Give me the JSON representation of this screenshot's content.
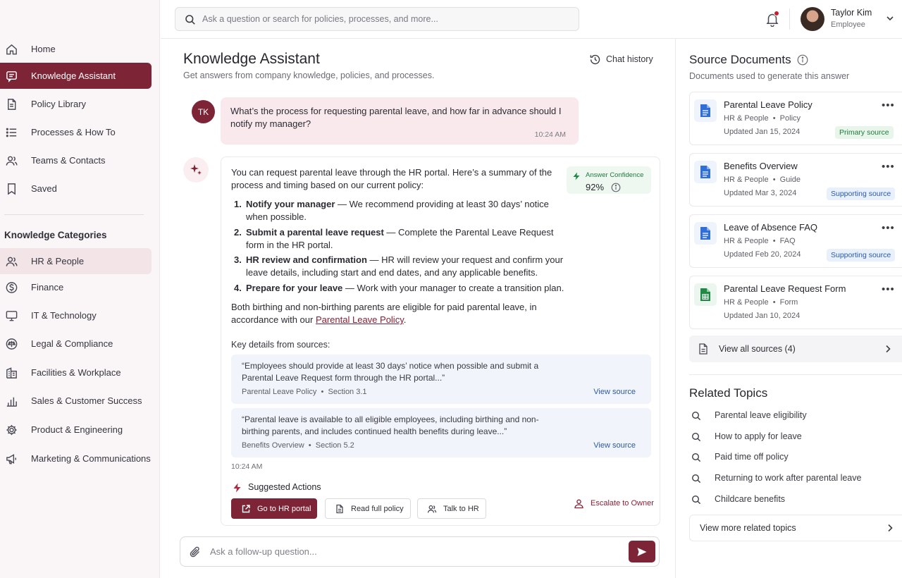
{
  "search": {
    "placeholder": "Ask a question or search for policies, processes, and more..."
  },
  "user": {
    "name": "Taylor Kim",
    "role": "Employee"
  },
  "sidebar": {
    "items": [
      {
        "label": "Home",
        "icon": "home-icon"
      },
      {
        "label": "Knowledge Assistant",
        "icon": "chat-icon",
        "active": true
      },
      {
        "label": "Policy Library",
        "icon": "document-icon"
      },
      {
        "label": "Processes & How To",
        "icon": "list-icon"
      },
      {
        "label": "Teams & Contacts",
        "icon": "people-icon"
      },
      {
        "label": "Saved",
        "icon": "bookmark-icon"
      }
    ],
    "categories_heading": "Knowledge Categories",
    "categories": [
      {
        "label": "HR & People",
        "icon": "people-icon",
        "highlighted": true
      },
      {
        "label": "Finance",
        "icon": "currency-icon"
      },
      {
        "label": "IT & Technology",
        "icon": "monitor-icon"
      },
      {
        "label": "Legal & Compliance",
        "icon": "scale-icon"
      },
      {
        "label": "Facilities & Workplace",
        "icon": "building-icon"
      },
      {
        "label": "Sales & Customer Success",
        "icon": "bar-chart-icon"
      },
      {
        "label": "Product & Engineering",
        "icon": "gear-icon"
      },
      {
        "label": "Marketing & Communications",
        "icon": "megaphone-icon"
      }
    ]
  },
  "main": {
    "title": "Knowledge Assistant",
    "subtitle": "Get answers from company knowledge, policies, and processes.",
    "chat_history_label": "Chat history"
  },
  "conversation": {
    "user_initials": "TK",
    "question": "What’s the process for requesting parental leave, and how far in advance should I notify my manager?",
    "question_time": "10:24 AM",
    "answer_intro": "You can request parental leave through the HR portal. Here’s a summary of the process and timing based on our current policy:",
    "confidence_label": "Answer Confidence",
    "confidence_value": "92%",
    "steps": [
      {
        "num": "1.",
        "title": "Notify your manager",
        "text": " — We recommend providing at least 30 days’ notice when possible."
      },
      {
        "num": "2.",
        "title": "Submit a parental leave request",
        "text": " — Complete the Parental Leave Request form in the HR portal."
      },
      {
        "num": "3.",
        "title": "HR review and confirmation",
        "text": " — HR will review your request and confirm your leave details, including start and end dates, and any applicable benefits."
      },
      {
        "num": "4.",
        "title": "Prepare for your leave",
        "text": " — Work with your manager to create a transition plan."
      }
    ],
    "eligibility_text": "Both birthing and non-birthing parents are eligible for paid parental leave, in accordance with our ",
    "eligibility_link": "Parental Leave Policy",
    "eligibility_end": ".",
    "key_details_heading": "Key details from sources:",
    "quotes": [
      {
        "text": "“Employees should provide at least 30 days’ notice when possible and submit a Parental Leave Request form through the HR portal...”",
        "source": "Parental Leave Policy",
        "section": "Section 3.1",
        "view": "View source"
      },
      {
        "text": "“Parental leave is available to all eligible employees, including birthing and non-birthing parents, and includes continued health benefits during leave...”",
        "source": "Benefits Overview",
        "section": "Section 5.2",
        "view": "View source"
      }
    ],
    "answer_time": "10:24 AM",
    "suggested_heading": "Suggested Actions",
    "actions": [
      {
        "label": "Go to HR portal",
        "icon": "external-link-icon"
      },
      {
        "label": "Read full policy",
        "icon": "document-icon"
      },
      {
        "label": "Talk to HR",
        "icon": "people-icon"
      }
    ],
    "escalate_label": "Escalate to Owner",
    "followup_placeholder": "Ask a follow-up question..."
  },
  "sources": {
    "title": "Source Documents",
    "subtitle": "Documents used to generate this answer",
    "docs": [
      {
        "title": "Parental Leave Policy",
        "category": "HR & People",
        "type": "Policy",
        "updated": "Updated Jan 15, 2024",
        "badge": "Primary source",
        "icon": "document-icon",
        "color": "#2f6fd6"
      },
      {
        "title": "Benefits Overview",
        "category": "HR & People",
        "type": "Guide",
        "updated": "Updated Mar 3, 2024",
        "badge": "Supporting source",
        "icon": "document-icon",
        "color": "#2f6fd6"
      },
      {
        "title": "Leave of Absence FAQ",
        "category": "HR & People",
        "type": "FAQ",
        "updated": "Updated Feb 20, 2024",
        "badge": "Supporting source",
        "icon": "document-icon",
        "color": "#2f6fd6"
      },
      {
        "title": "Parental Leave Request Form",
        "category": "HR & People",
        "type": "Form",
        "updated": "Updated Jan 10, 2024",
        "badge": "",
        "icon": "spreadsheet-icon",
        "color": "#1f8a43"
      }
    ],
    "view_all_label": "View all sources (4)"
  },
  "related": {
    "title": "Related Topics",
    "topics": [
      "Parental leave eligibility",
      "How to apply for leave",
      "Paid time off policy",
      "Returning to work after parental leave",
      "Childcare benefits"
    ],
    "view_more_label": "View more related topics"
  }
}
